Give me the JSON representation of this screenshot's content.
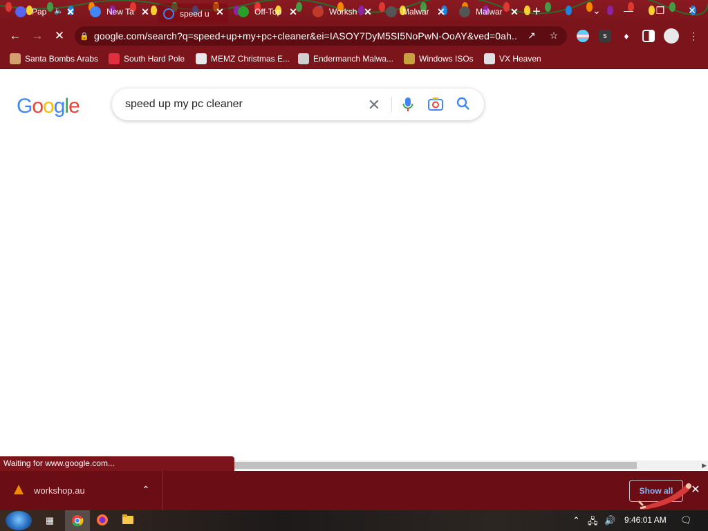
{
  "window": {
    "tabs": [
      {
        "title": "Pap",
        "favicon_color": "#5865f2",
        "active": false,
        "audio": true
      },
      {
        "title": "New Ta",
        "favicon_color": "#4285f4",
        "active": false,
        "audio": false
      },
      {
        "title": "speed u",
        "favicon_color": "#4285f4",
        "active": true,
        "audio": false
      },
      {
        "title": "Off-Top",
        "favicon_color": "#2a9d2a",
        "active": false,
        "audio": false
      },
      {
        "title": "Worksh",
        "favicon_color": "#c0392b",
        "active": false,
        "audio": false
      },
      {
        "title": "Malwar",
        "favicon_color": "#555555",
        "active": false,
        "audio": false
      },
      {
        "title": "Malwar",
        "favicon_color": "#555555",
        "active": false,
        "audio": false
      }
    ],
    "new_tab_icon": "plus-icon",
    "controls": [
      "chevron-down-icon",
      "minimize-icon",
      "restore-icon",
      "close-icon"
    ]
  },
  "toolbar": {
    "url": "google.com/search?q=speed+up+my+pc+cleaner&ei=IASOY7DyM5SI5NoPwN-OoAY&ved=0ah...",
    "loading": true
  },
  "bookmarks": [
    {
      "label": "Santa Bombs Arabs",
      "icon_color": "#d4a070"
    },
    {
      "label": "South Hard Pole",
      "icon_color": "#e03040"
    },
    {
      "label": "MEMZ Christmas E...",
      "icon_color": "#e8e8e8"
    },
    {
      "label": "Endermanch Malwa...",
      "icon_color": "#cfcfcf"
    },
    {
      "label": "Windows ISOs",
      "icon_color": "#c8a040"
    },
    {
      "label": "VX Heaven",
      "icon_color": "#e0e0e0"
    }
  ],
  "page": {
    "logo_letters": [
      {
        "ch": "G",
        "color": "#4285f4"
      },
      {
        "ch": "o",
        "color": "#ea4335"
      },
      {
        "ch": "o",
        "color": "#fbbc05"
      },
      {
        "ch": "g",
        "color": "#4285f4"
      },
      {
        "ch": "l",
        "color": "#34a853"
      },
      {
        "ch": "e",
        "color": "#ea4335"
      }
    ],
    "search_query": "speed up my pc cleaner",
    "status_text": "Waiting for www.google.com..."
  },
  "downloads": {
    "items": [
      {
        "name": "workshop.au"
      }
    ],
    "show_all_label": "Show all"
  },
  "taskbar": {
    "time": "9:46:01 AM"
  },
  "theme": {
    "accent": "#7b151b",
    "tab_strip": "#8a1a22",
    "shelf": "#6a0d14"
  }
}
